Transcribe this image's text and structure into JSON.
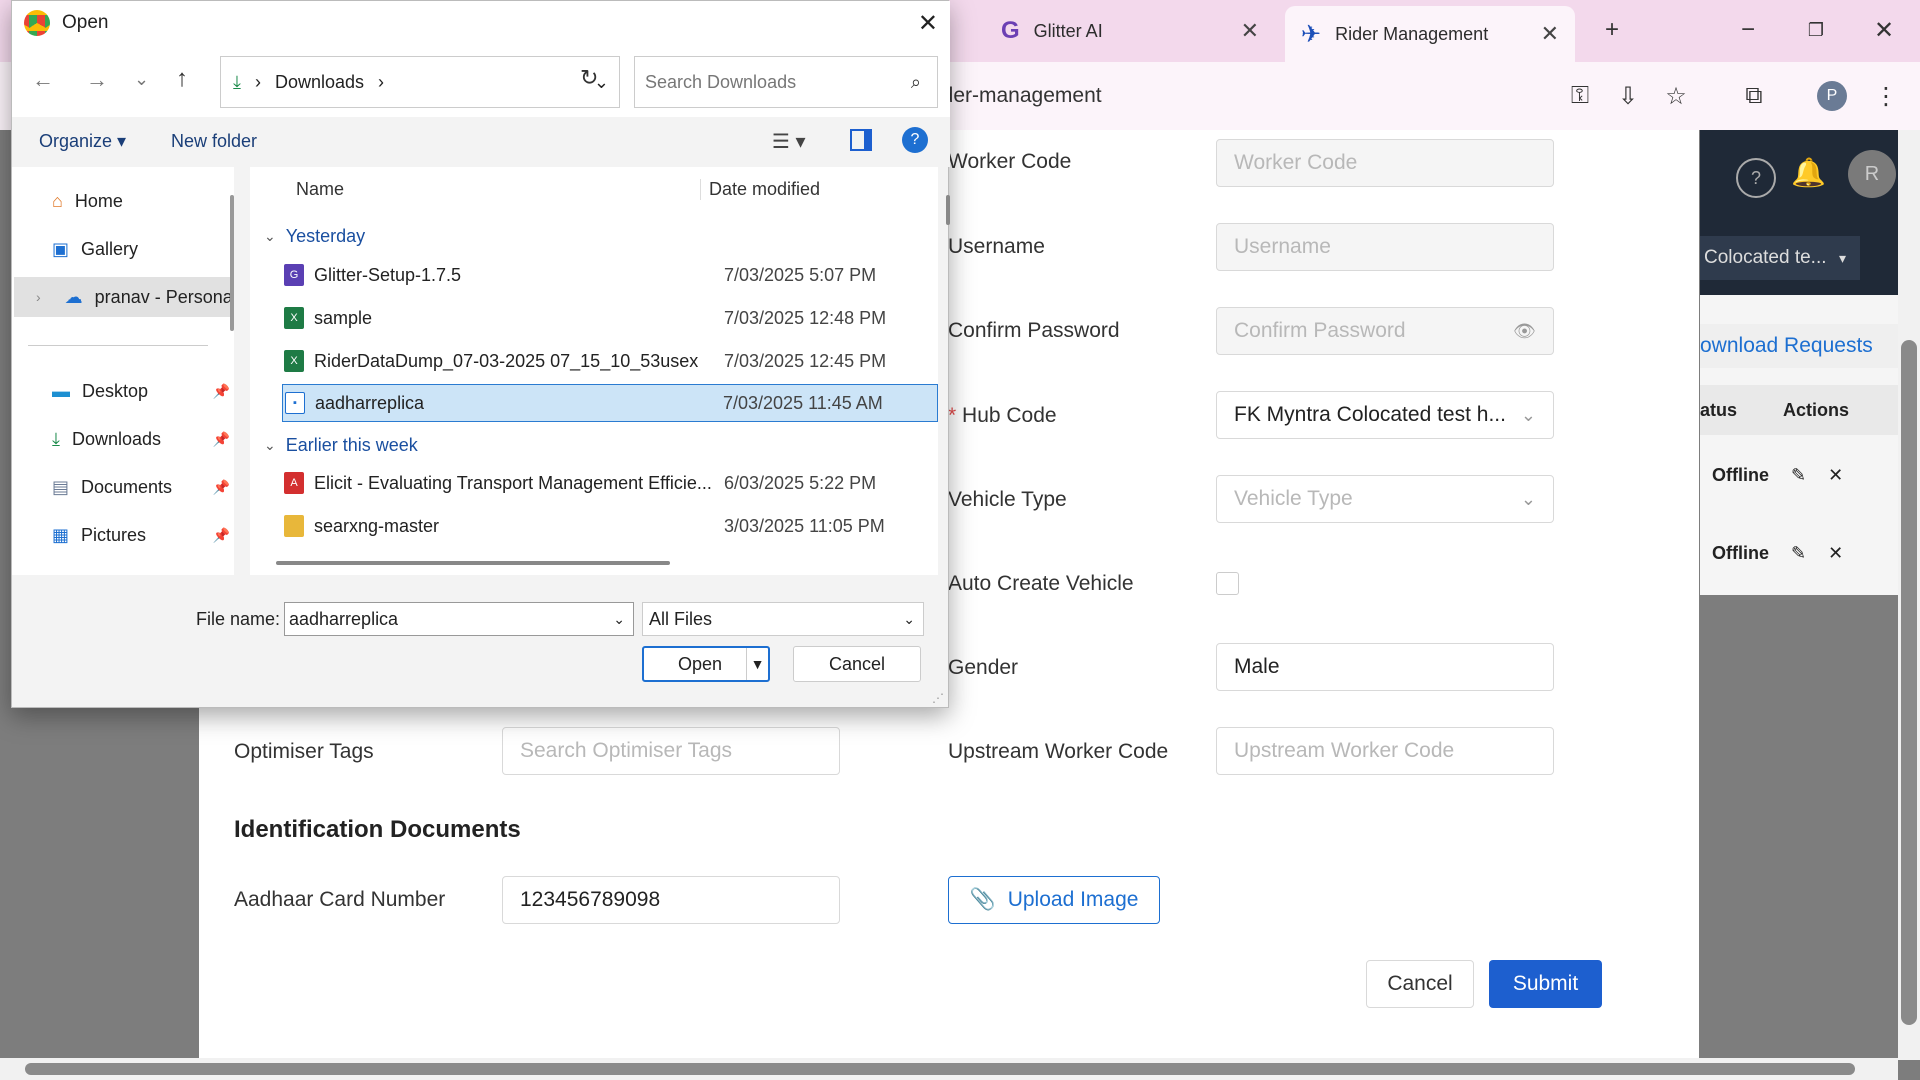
{
  "browser": {
    "tabs": [
      {
        "title": "Glitter AI",
        "active": false
      },
      {
        "title": "Rider Management",
        "active": true
      }
    ],
    "url": "rider-management",
    "profile_initial": "P"
  },
  "app": {
    "header": {
      "user_initial": "R",
      "hub_select": "Colocated te..."
    },
    "download_requests_link": "ownload Requests",
    "table": {
      "headers": [
        "atus",
        "Actions"
      ],
      "rows": [
        {
          "status": "Offline"
        },
        {
          "status": "Offline"
        }
      ]
    }
  },
  "form": {
    "worker_code": {
      "label": "Worker Code",
      "placeholder": "Worker Code"
    },
    "username": {
      "label": "Username",
      "placeholder": "Username"
    },
    "confirm_password": {
      "label": "Confirm Password",
      "placeholder": "Confirm Password"
    },
    "hub_code": {
      "required_mark": "*",
      "label": "Hub Code",
      "value": "FK Myntra Colocated test h..."
    },
    "vehicle_type": {
      "label": "Vehicle Type",
      "placeholder": "Vehicle Type"
    },
    "auto_create_vehicle": {
      "label": "Auto Create Vehicle",
      "checked": false
    },
    "gender": {
      "label": "Gender",
      "value": "Male"
    },
    "optimiser_tags": {
      "label": "Optimiser Tags",
      "placeholder": "Search Optimiser Tags"
    },
    "upstream_worker_code": {
      "label": "Upstream Worker Code",
      "placeholder": "Upstream Worker Code"
    },
    "identification_heading": "Identification Documents",
    "aadhaar": {
      "label": "Aadhaar Card Number",
      "value": "123456789098"
    },
    "upload_label": "Upload Image",
    "cancel_label": "Cancel",
    "submit_label": "Submit"
  },
  "dialog": {
    "title": "Open",
    "path": [
      "Downloads"
    ],
    "search_placeholder": "Search Downloads",
    "organize_label": "Organize",
    "new_folder_label": "New folder",
    "nav": {
      "quick": [
        {
          "label": "Home",
          "icon": "home-icon"
        },
        {
          "label": "Gallery",
          "icon": "gallery-icon"
        },
        {
          "label": "pranav - Persona",
          "icon": "cloud-icon"
        }
      ],
      "pinned": [
        {
          "label": "Desktop",
          "icon": "desktop-icon"
        },
        {
          "label": "Downloads",
          "icon": "download-icon"
        },
        {
          "label": "Documents",
          "icon": "documents-icon"
        },
        {
          "label": "Pictures",
          "icon": "pictures-icon"
        }
      ]
    },
    "columns": {
      "name": "Name",
      "date": "Date modified"
    },
    "groups": [
      {
        "label": "Yesterday",
        "files": [
          {
            "name": "Glitter-Setup-1.7.5",
            "date": "7/03/2025 5:07 PM",
            "icon": "app-icon",
            "selected": false
          },
          {
            "name": "sample",
            "date": "7/03/2025 12:48 PM",
            "icon": "excel-icon",
            "selected": false
          },
          {
            "name": "RiderDataDump_07-03-2025 07_15_10_53usex",
            "date": "7/03/2025 12:45 PM",
            "icon": "excel-icon",
            "selected": false
          },
          {
            "name": "aadharreplica",
            "date": "7/03/2025 11:45 AM",
            "icon": "image-icon",
            "selected": true
          }
        ]
      },
      {
        "label": "Earlier this week",
        "files": [
          {
            "name": "Elicit - Evaluating Transport Management Efficie...",
            "date": "6/03/2025 5:22 PM",
            "icon": "pdf-icon",
            "selected": false
          },
          {
            "name": "searxng-master",
            "date": "3/03/2025 11:05 PM",
            "icon": "folder-icon",
            "selected": false
          }
        ]
      }
    ],
    "file_name_label": "File name:",
    "file_name_value": "aadharreplica",
    "filter_value": "All Files",
    "open_label": "Open",
    "cancel_label": "Cancel"
  }
}
